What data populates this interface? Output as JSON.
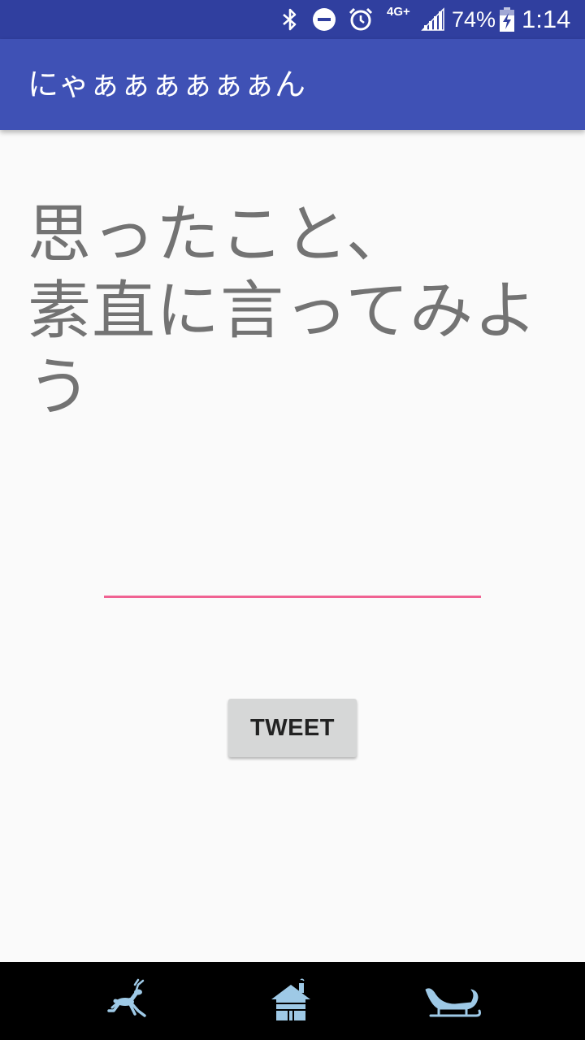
{
  "status_bar": {
    "battery_percent": "74%",
    "time": "1:14",
    "network_type": "4G+",
    "icons": [
      "bluetooth-icon",
      "do-not-disturb-icon",
      "alarm-icon",
      "signal-icon",
      "battery-charging-icon"
    ]
  },
  "app_bar": {
    "title": "にゃぁぁぁぁぁぁん"
  },
  "main": {
    "headline": "思ったこと、\n素直に言ってみよう",
    "input_value": "",
    "tweet_label": "TWEET"
  },
  "bottom_nav": {
    "items": [
      {
        "icon": "reindeer-icon"
      },
      {
        "icon": "house-icon"
      },
      {
        "icon": "sleigh-icon"
      }
    ]
  },
  "colors": {
    "status_bar": "#303f9f",
    "app_bar": "#3f51b5",
    "accent_underline": "#f06292",
    "nav_icon": "#9ec9e6",
    "headline_text": "#737373",
    "button_bg": "#d6d7d7"
  }
}
